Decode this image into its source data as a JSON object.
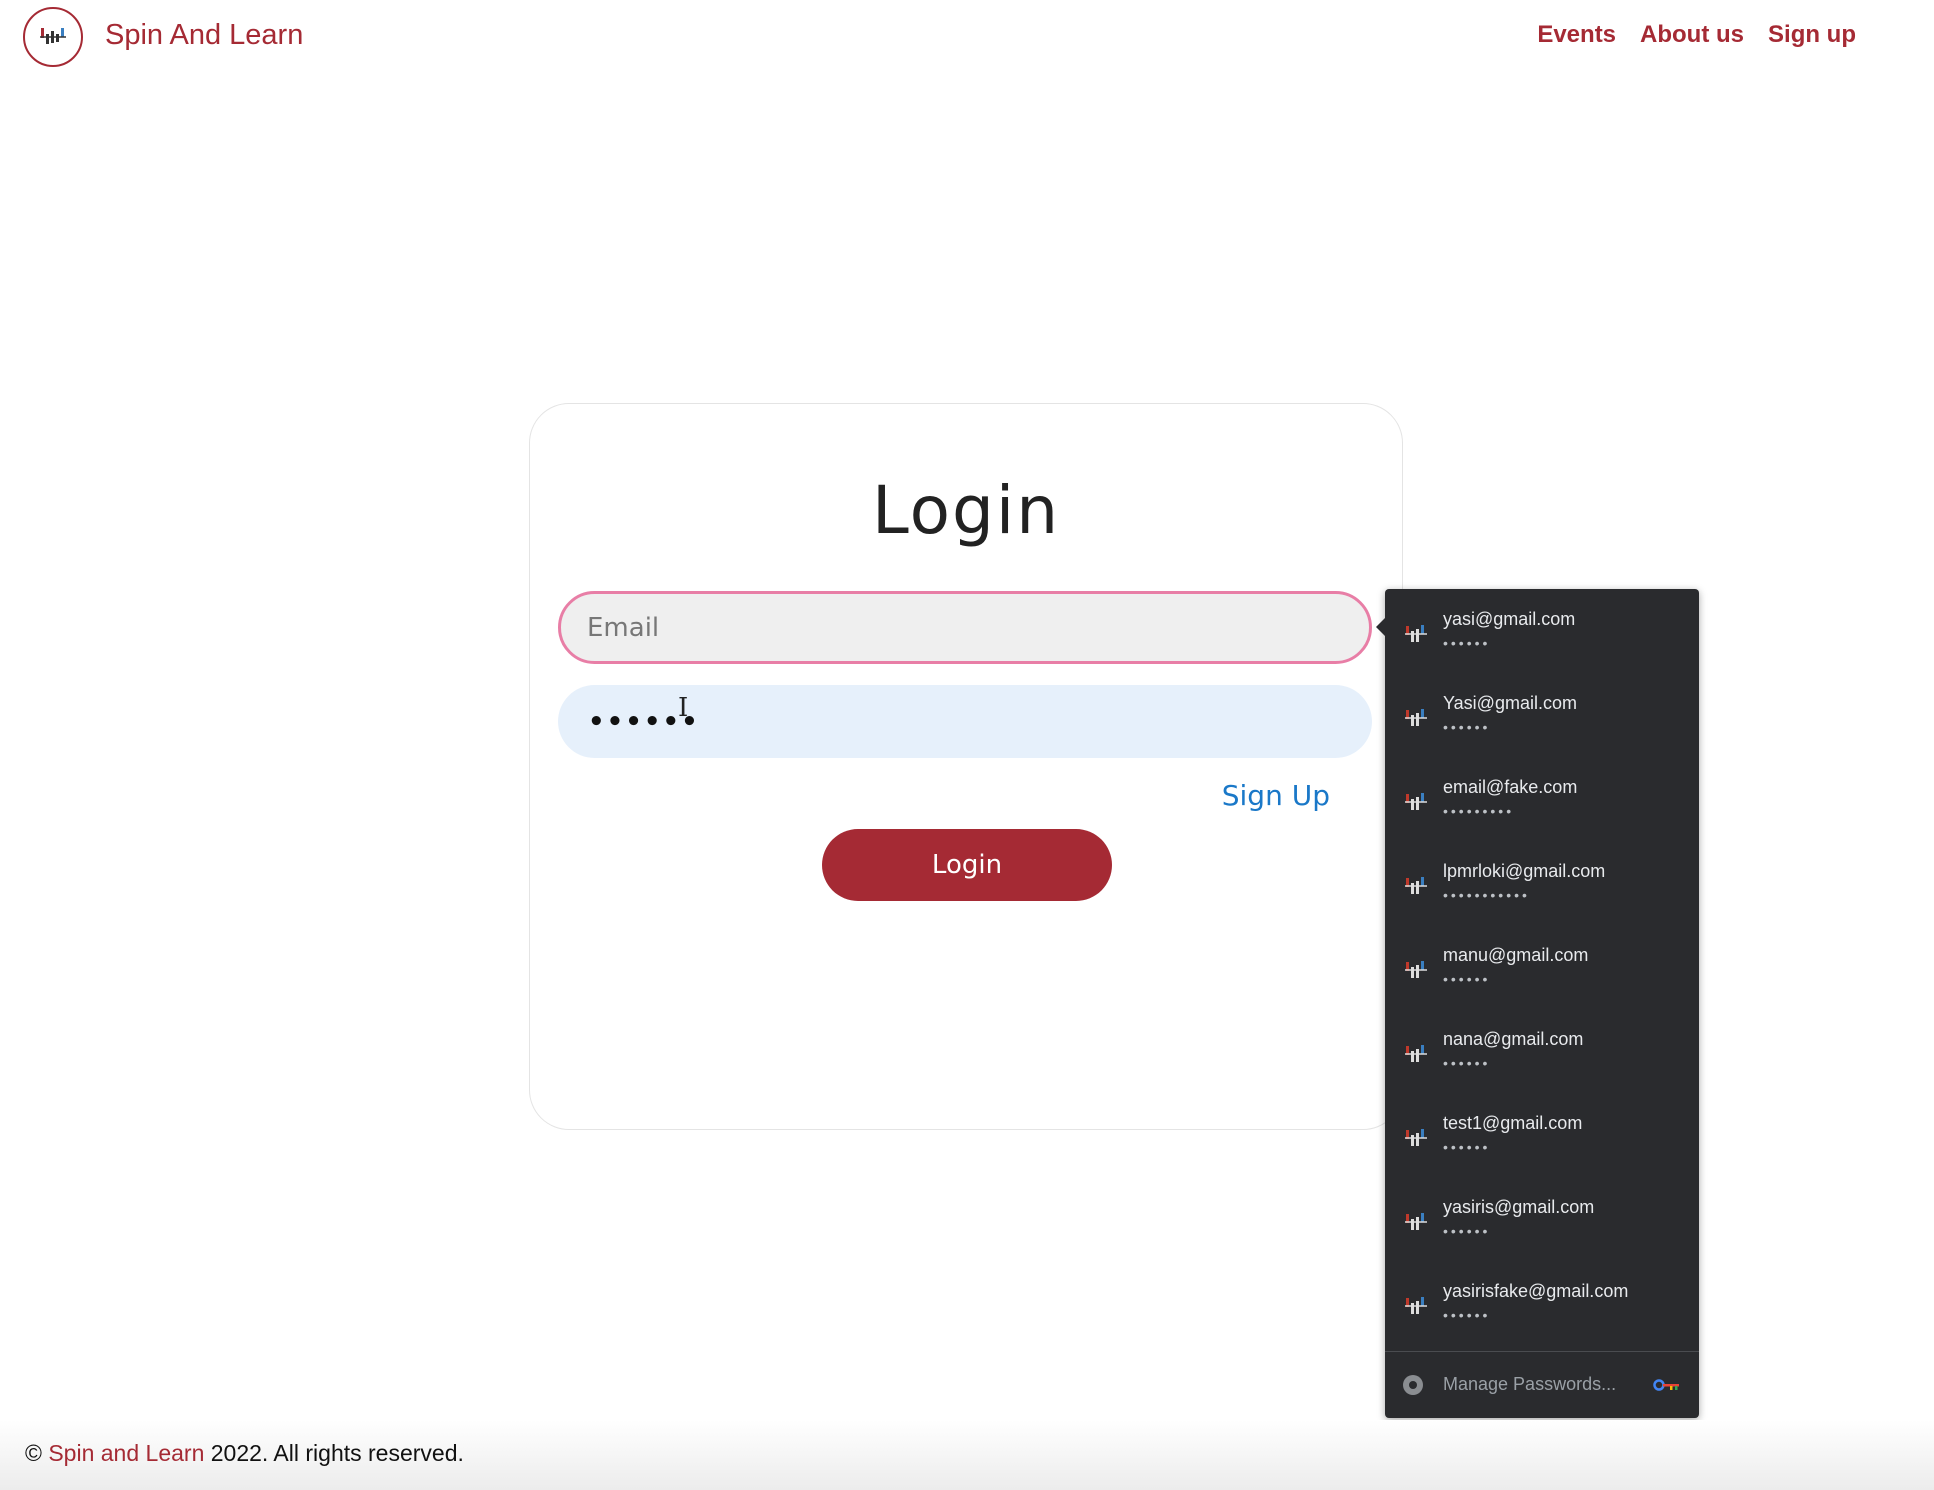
{
  "header": {
    "brand": "Spin And Learn",
    "logo_icon": "spin-and-learn-logo",
    "nav": [
      "Events",
      "About us",
      "Sign up"
    ]
  },
  "login": {
    "title": "Login",
    "email_placeholder": "Email",
    "email_value": "",
    "password_mask": "••••••",
    "signup_link": "Sign Up",
    "login_button": "Login"
  },
  "password_dropdown": {
    "accounts": [
      {
        "user": "yasi@gmail.com",
        "mask": "••••••"
      },
      {
        "user": "Yasi@gmail.com",
        "mask": "••••••"
      },
      {
        "user": "email@fake.com",
        "mask": "•••••••••"
      },
      {
        "user": "lpmrloki@gmail.com",
        "mask": "•••••••••••"
      },
      {
        "user": "manu@gmail.com",
        "mask": "••••••"
      },
      {
        "user": "nana@gmail.com",
        "mask": "••••••"
      },
      {
        "user": "test1@gmail.com",
        "mask": "••••••"
      },
      {
        "user": "yasiris@gmail.com",
        "mask": "••••••"
      },
      {
        "user": "yasirisfake@gmail.com",
        "mask": "••••••"
      }
    ],
    "manage_label": "Manage Passwords..."
  },
  "footer": {
    "copyright_symbol": "©",
    "brand": "Spin and Learn",
    "rest": "2022. All rights reserved."
  },
  "colors": {
    "brand": "#a52a34",
    "link": "#1a78c8",
    "email_focus_border": "#e87ea6",
    "dropdown_bg": "#2a2b2e"
  }
}
